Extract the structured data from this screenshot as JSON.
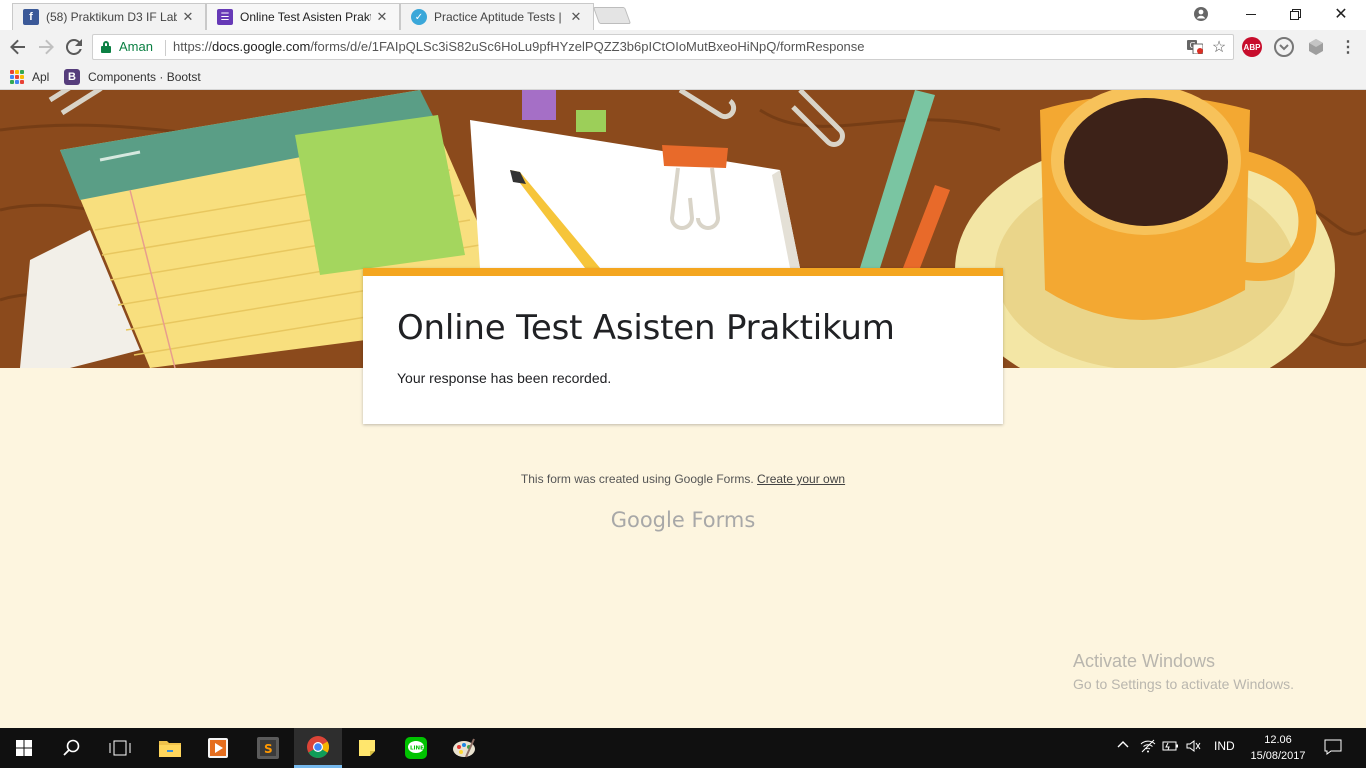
{
  "browser": {
    "tabs": [
      {
        "title": "(58) Praktikum D3 IF Lab",
        "favicon": "facebook-icon",
        "active": false
      },
      {
        "title": "Online Test Asisten Praktikum",
        "favicon": "google-forms-icon",
        "active": true
      },
      {
        "title": "Practice Aptitude Tests | Fr",
        "favicon": "checkmark-icon",
        "active": false
      }
    ],
    "secure_label": "Aman",
    "url_scheme": "https://",
    "url_host": "docs.google.com",
    "url_path": "/forms/d/e/1FAIpQLSc3iS82uSc6HoLu9pfHYzelPQZZ3b6pICtOIoMutBxeoHiNpQ/formResponse",
    "bookmarks": [
      {
        "label": "Apl",
        "icon": "apps-grid-icon"
      },
      {
        "label": "Components · Bootst",
        "icon": "bootstrap-icon"
      }
    ],
    "extensions": [
      {
        "name": "adblock-plus-icon",
        "label": "ABP",
        "color": "#c70d2c"
      }
    ]
  },
  "form": {
    "title": "Online Test Asisten Praktikum",
    "message": "Your response has been recorded.",
    "accent_color": "#f4a620"
  },
  "footer": {
    "note": "This form was created using Google Forms.",
    "create_link": "Create your own",
    "logo_google": "Google",
    "logo_forms": "Forms"
  },
  "watermark": {
    "title": "Activate Windows",
    "subtitle": "Go to Settings to activate Windows."
  },
  "taskbar": {
    "language": "IND",
    "time": "12.06",
    "date": "15/08/2017"
  }
}
